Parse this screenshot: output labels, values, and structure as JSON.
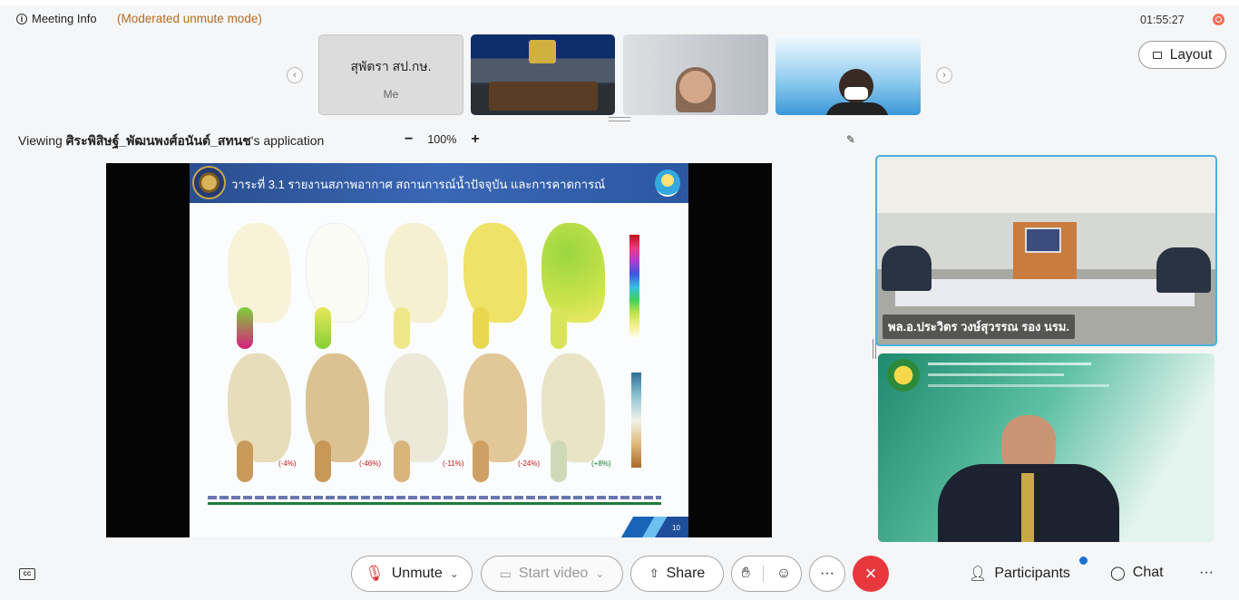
{
  "header": {
    "meeting_info": "Meeting Info",
    "mode": "(Moderated unmute mode)",
    "timer": "01:55:27"
  },
  "thumbnails": {
    "me_name": "สุพัตรา สป.กษ.",
    "me_label": "Me",
    "layout_label": "Layout"
  },
  "viewing": {
    "prefix": "Viewing ",
    "owner": "ศิระพิสิษฐ์_พัฒนพงศ์อนันต์_สทนช",
    "suffix": "'s application",
    "zoom_minus": "−",
    "zoom_level": "100%",
    "zoom_plus": "+"
  },
  "slide": {
    "title": "วาระที่ 3.1 รายงานสภาพอากาศ สถานการณ์น้ำปัจจุบัน และการคาดการณ์",
    "percents": [
      "(-4%)",
      "(-46%)",
      "(-11%)",
      "(-24%)",
      "(+8%)"
    ],
    "page_number": "10"
  },
  "videos": {
    "participant1_name": "พล.อ.ประวิตร วงษ์สุวรรณ รอง นรม."
  },
  "controls": {
    "unmute": "Unmute",
    "start_video": "Start video",
    "share": "Share",
    "participants": "Participants",
    "chat": "Chat",
    "more": "···"
  },
  "colors": {
    "leave": "#e8383d",
    "active_speaker_border": "#4ab0e0",
    "mode_text": "#b86a1e"
  }
}
